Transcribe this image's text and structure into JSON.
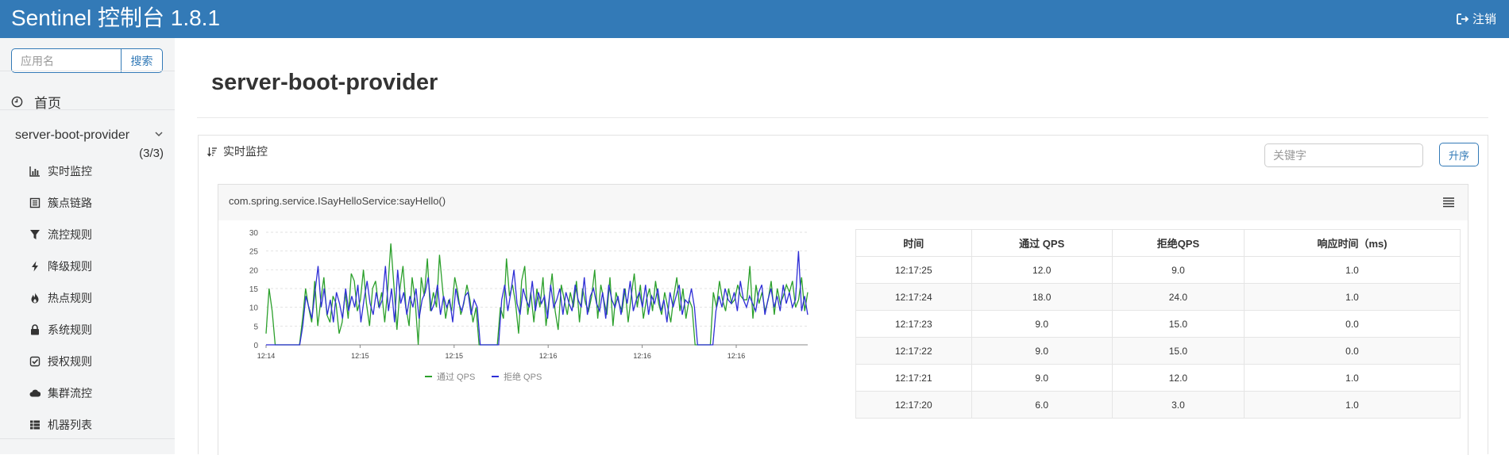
{
  "navbar": {
    "brand": "Sentinel 控制台 1.8.1",
    "logout_label": "注销",
    "logout_icon": "sign-out-icon"
  },
  "sidebar": {
    "search_placeholder": "应用名",
    "search_button": "搜索",
    "home_label": "首页",
    "app": {
      "name": "server-boot-provider",
      "count": "(3/3)"
    },
    "items": [
      {
        "label": "实时监控",
        "icon": "bar-chart-icon"
      },
      {
        "label": "簇点链路",
        "icon": "list-icon"
      },
      {
        "label": "流控规则",
        "icon": "filter-icon"
      },
      {
        "label": "降级规则",
        "icon": "bolt-icon"
      },
      {
        "label": "热点规则",
        "icon": "fire-icon"
      },
      {
        "label": "系统规则",
        "icon": "lock-icon"
      },
      {
        "label": "授权规则",
        "icon": "check-square-icon"
      },
      {
        "label": "集群流控",
        "icon": "cloud-icon"
      },
      {
        "label": "机器列表",
        "icon": "th-list-icon"
      }
    ]
  },
  "main": {
    "title": "server-boot-provider",
    "panel_title": "实时监控",
    "keyword_placeholder": "关键字",
    "sort_button": "升序",
    "resource": "com.spring.service.ISayHelloService:sayHello()",
    "table": {
      "headers": [
        "时间",
        "通过 QPS",
        "拒绝QPS",
        "响应时间（ms)"
      ],
      "rows": [
        [
          "12:17:25",
          "12.0",
          "9.0",
          "1.0"
        ],
        [
          "12:17:24",
          "18.0",
          "24.0",
          "1.0"
        ],
        [
          "12:17:23",
          "9.0",
          "15.0",
          "0.0"
        ],
        [
          "12:17:22",
          "9.0",
          "15.0",
          "0.0"
        ],
        [
          "12:17:21",
          "9.0",
          "12.0",
          "1.0"
        ],
        [
          "12:17:20",
          "6.0",
          "3.0",
          "1.0"
        ]
      ]
    }
  },
  "chart_data": {
    "type": "line",
    "ylim": [
      0,
      30
    ],
    "yticks": [
      0,
      5,
      10,
      15,
      20,
      25,
      30
    ],
    "xticks": [
      "12:14",
      "12:15",
      "12:15",
      "12:16",
      "12:16",
      "12:16"
    ],
    "grid": true,
    "legend_position": "bottom",
    "series": [
      {
        "name": "通过 QPS",
        "color": "#2ca02c",
        "values": [
          3,
          15,
          9,
          0,
          0,
          0,
          0,
          0,
          0,
          0,
          0,
          0,
          7,
          15,
          10,
          6,
          17,
          5,
          12,
          18,
          8,
          6,
          13,
          11,
          3,
          6,
          14,
          7,
          19,
          17,
          9,
          12,
          20,
          11,
          5,
          15,
          17,
          10,
          14,
          6,
          15,
          27,
          16,
          4,
          15,
          21,
          10,
          5,
          18,
          12,
          0,
          18,
          13,
          23,
          9,
          14,
          10,
          24,
          15,
          7,
          12,
          9,
          18,
          14,
          8,
          11,
          16,
          12,
          6,
          10,
          0,
          0,
          0,
          0,
          0,
          0,
          0,
          10,
          7,
          23,
          13,
          16,
          11,
          3,
          17,
          21,
          8,
          14,
          6,
          15,
          10,
          18,
          5,
          12,
          19,
          9,
          4,
          16,
          12,
          8,
          14,
          10,
          17,
          6,
          15,
          11,
          9,
          13,
          20,
          7,
          16,
          12,
          8,
          18,
          5,
          14,
          11,
          9,
          15,
          6,
          13,
          19,
          10,
          16,
          7,
          12,
          15,
          9,
          17,
          11,
          8,
          14,
          10,
          6,
          13,
          18,
          9,
          15,
          7,
          12,
          10,
          0,
          0,
          0,
          0,
          0,
          0,
          14,
          10,
          17,
          12,
          9,
          15,
          11,
          12,
          16,
          13,
          12,
          12,
          21,
          7,
          16,
          11,
          14,
          9,
          12,
          17,
          8,
          15,
          11,
          13,
          16,
          14,
          17,
          10,
          12,
          18,
          9,
          14
        ]
      },
      {
        "name": "拒绝 QPS",
        "color": "#2f2fd6",
        "values": [
          0,
          0,
          0,
          0,
          0,
          0,
          0,
          0,
          0,
          0,
          0,
          0,
          5,
          13,
          10,
          7,
          14,
          21,
          10,
          15,
          8,
          12,
          6,
          14,
          11,
          7,
          15,
          9,
          13,
          10,
          16,
          6,
          12,
          17,
          11,
          8,
          14,
          10,
          12,
          21,
          9,
          15,
          6,
          20,
          11,
          14,
          8,
          13,
          10,
          15,
          7,
          12,
          14,
          18,
          9,
          11,
          16,
          8,
          13,
          10,
          12,
          6,
          15,
          11,
          9,
          13,
          14,
          8,
          12,
          10,
          0,
          0,
          0,
          0,
          0,
          0,
          0,
          12,
          16,
          9,
          14,
          20,
          11,
          8,
          15,
          12,
          10,
          17,
          9,
          14,
          11,
          13,
          7,
          16,
          10,
          12,
          15,
          8,
          14,
          11,
          9,
          16,
          12,
          10,
          18,
          8,
          13,
          15,
          11,
          9,
          14,
          7,
          16,
          12,
          10,
          13,
          8,
          15,
          11,
          17,
          9,
          12,
          14,
          10,
          16,
          8,
          13,
          11,
          15,
          9,
          12,
          6,
          14,
          10,
          13,
          16,
          8,
          12,
          11,
          15,
          10,
          0,
          0,
          0,
          0,
          0,
          0,
          9,
          13,
          10,
          15,
          12,
          11,
          14,
          9,
          17,
          12,
          10,
          13,
          11,
          9,
          14,
          16,
          8,
          12,
          15,
          10,
          13,
          9,
          16,
          11,
          14,
          10,
          12,
          25,
          9,
          13,
          8
        ]
      }
    ]
  }
}
